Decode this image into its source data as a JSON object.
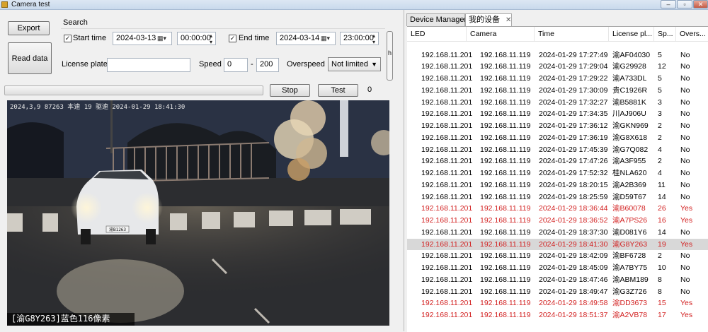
{
  "window": {
    "title": "Camera test",
    "min": "–",
    "max": "▫",
    "close": "✕"
  },
  "toolbar": {
    "export": "Export",
    "read": "Read data",
    "stop": "Stop",
    "test": "Test",
    "count": "0"
  },
  "search": {
    "group": "Search",
    "start_label": "Start time",
    "start_checked": "✓",
    "start_date": "2024-03-13",
    "start_time": "00:00:00",
    "end_label": "End time",
    "end_checked": "✓",
    "end_date": "2024-03-14",
    "end_time": "23:00:00",
    "plate_label": "License plate",
    "plate_value": "",
    "speed_label": "Speed",
    "speed_min": "0",
    "speed_sep": "-",
    "speed_max": "200",
    "overspeed_label": "Overspeed",
    "overspeed_value": "Not limited",
    "scroll_glyph": "h"
  },
  "camera": {
    "timestamp": "2024,3,9 87263 本速 19 驱速   2024-01-29 18:41:30",
    "caption": "[渝G8Y263]蓝色116像素",
    "plate": "渝B1263"
  },
  "tabs": [
    {
      "label": "Device Manager"
    },
    {
      "label": "我的设备",
      "close": "✕"
    }
  ],
  "table": {
    "columns": [
      "LED",
      "Camera",
      "Time",
      "License pl...",
      "Sp...",
      "Overs..."
    ],
    "rows": [
      {
        "led": "192.168.11.201",
        "cam": "192.168.11.119",
        "time": "2024-01-29 17:27:49",
        "plate": "渝AF04030",
        "speed": "5",
        "over": "No",
        "red": false
      },
      {
        "led": "192.168.11.201",
        "cam": "192.168.11.119",
        "time": "2024-01-29 17:29:04",
        "plate": "渝G29928",
        "speed": "12",
        "over": "No",
        "red": false
      },
      {
        "led": "192.168.11.201",
        "cam": "192.168.11.119",
        "time": "2024-01-29 17:29:22",
        "plate": "渝A733DL",
        "speed": "5",
        "over": "No",
        "red": false
      },
      {
        "led": "192.168.11.201",
        "cam": "192.168.11.119",
        "time": "2024-01-29 17:30:09",
        "plate": "贵C1926R",
        "speed": "5",
        "over": "No",
        "red": false
      },
      {
        "led": "192.168.11.201",
        "cam": "192.168.11.119",
        "time": "2024-01-29 17:32:27",
        "plate": "渝B5881K",
        "speed": "3",
        "over": "No",
        "red": false
      },
      {
        "led": "192.168.11.201",
        "cam": "192.168.11.119",
        "time": "2024-01-29 17:34:35",
        "plate": "川AJ906U",
        "speed": "3",
        "over": "No",
        "red": false
      },
      {
        "led": "192.168.11.201",
        "cam": "192.168.11.119",
        "time": "2024-01-29 17:36:12",
        "plate": "渝GKN969",
        "speed": "2",
        "over": "No",
        "red": false
      },
      {
        "led": "192.168.11.201",
        "cam": "192.168.11.119",
        "time": "2024-01-29 17:36:19",
        "plate": "渝G8X618",
        "speed": "2",
        "over": "No",
        "red": false
      },
      {
        "led": "192.168.11.201",
        "cam": "192.168.11.119",
        "time": "2024-01-29 17:45:39",
        "plate": "渝G7Q082",
        "speed": "4",
        "over": "No",
        "red": false
      },
      {
        "led": "192.168.11.201",
        "cam": "192.168.11.119",
        "time": "2024-01-29 17:47:26",
        "plate": "渝A3F955",
        "speed": "2",
        "over": "No",
        "red": false
      },
      {
        "led": "192.168.11.201",
        "cam": "192.168.11.119",
        "time": "2024-01-29 17:52:32",
        "plate": "桂NLA620",
        "speed": "4",
        "over": "No",
        "red": false
      },
      {
        "led": "192.168.11.201",
        "cam": "192.168.11.119",
        "time": "2024-01-29 18:20:15",
        "plate": "渝A2B369",
        "speed": "11",
        "over": "No",
        "red": false
      },
      {
        "led": "192.168.11.201",
        "cam": "192.168.11.119",
        "time": "2024-01-29 18:25:59",
        "plate": "渝D59T67",
        "speed": "14",
        "over": "No",
        "red": false
      },
      {
        "led": "192.168.11.201",
        "cam": "192.168.11.119",
        "time": "2024-01-29 18:36:44",
        "plate": "渝B60078",
        "speed": "26",
        "over": "Yes",
        "red": true
      },
      {
        "led": "192.168.11.201",
        "cam": "192.168.11.119",
        "time": "2024-01-29 18:36:52",
        "plate": "渝A7PS26",
        "speed": "16",
        "over": "Yes",
        "red": true
      },
      {
        "led": "192.168.11.201",
        "cam": "192.168.11.119",
        "time": "2024-01-29 18:37:30",
        "plate": "渝D081Y6",
        "speed": "14",
        "over": "No",
        "red": false
      },
      {
        "led": "192.168.11.201",
        "cam": "192.168.11.119",
        "time": "2024-01-29 18:41:30",
        "plate": "渝G8Y263",
        "speed": "19",
        "over": "Yes",
        "red": true,
        "selected": true
      },
      {
        "led": "192.168.11.201",
        "cam": "192.168.11.119",
        "time": "2024-01-29 18:42:09",
        "plate": "渝BF6728",
        "speed": "2",
        "over": "No",
        "red": false
      },
      {
        "led": "192.168.11.201",
        "cam": "192.168.11.119",
        "time": "2024-01-29 18:45:09",
        "plate": "渝A7BY75",
        "speed": "10",
        "over": "No",
        "red": false
      },
      {
        "led": "192.168.11.201",
        "cam": "192.168.11.119",
        "time": "2024-01-29 18:47:46",
        "plate": "渝ABM189",
        "speed": "8",
        "over": "No",
        "red": false
      },
      {
        "led": "192.168.11.201",
        "cam": "192.168.11.119",
        "time": "2024-01-29 18:49:47",
        "plate": "渝G3Z726",
        "speed": "8",
        "over": "No",
        "red": false
      },
      {
        "led": "192.168.11.201",
        "cam": "192.168.11.119",
        "time": "2024-01-29 18:49:58",
        "plate": "渝DD3673",
        "speed": "15",
        "over": "Yes",
        "red": true
      },
      {
        "led": "192.168.11.201",
        "cam": "192.168.11.119",
        "time": "2024-01-29 18:51:37",
        "plate": "渝A2VB78",
        "speed": "17",
        "over": "Yes",
        "red": true
      }
    ]
  },
  "colors": {
    "overspeed": "#d21f1f",
    "selected_row": "#d8d8d8"
  }
}
